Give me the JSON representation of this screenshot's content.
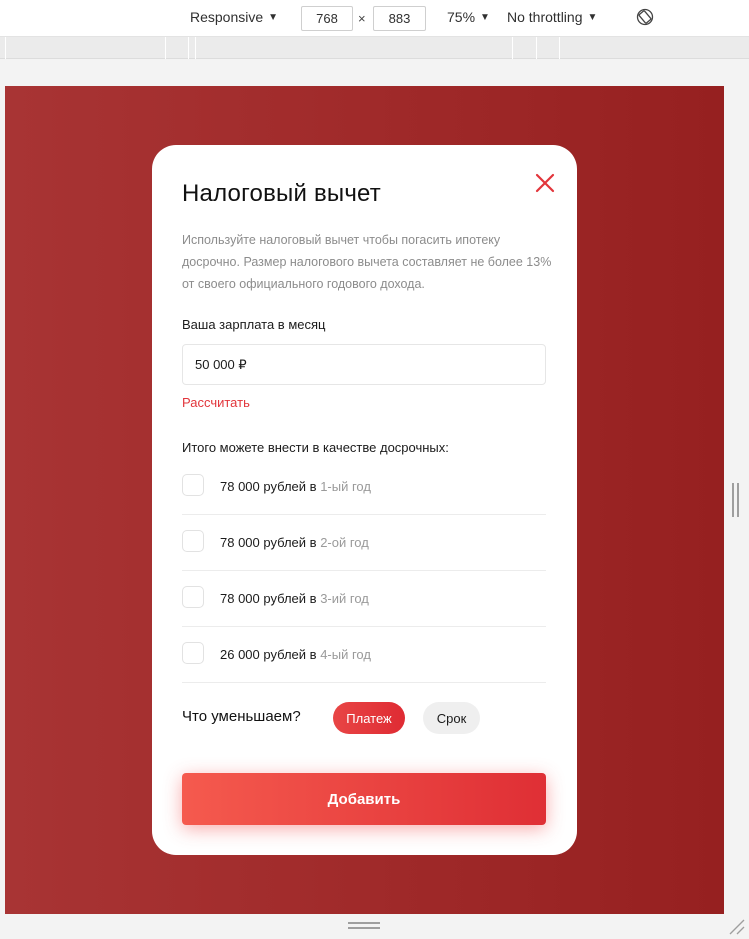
{
  "devtools": {
    "device": "Responsive",
    "width": "768",
    "times": "×",
    "height": "883",
    "zoom": "75%",
    "throttling": "No throttling",
    "rotate_icon": "rotate-icon"
  },
  "modal": {
    "title": "Налоговый вычет",
    "close_icon": "close-icon",
    "description": "Используйте налоговый вычет чтобы погасить ипотеку досрочно. Размер налогового вычета составляет не более 13% от своего официального годового дохода.",
    "salary_label": "Ваша зарплата в месяц",
    "salary_value": "50 000 ₽",
    "calc_link": "Рассчитать",
    "total_label": "Итого можете внести в качестве досрочных:",
    "options": [
      {
        "amount": "78 000 рублей в ",
        "year": "1-ый год",
        "checked": false
      },
      {
        "amount": "78 000 рублей в ",
        "year": "2-ой год",
        "checked": false
      },
      {
        "amount": "78 000 рублей в ",
        "year": "3-ий год",
        "checked": false
      },
      {
        "amount": "26 000 рублей в ",
        "year": "4-ый год",
        "checked": false
      }
    ],
    "reduce_label": "Что уменьшаем?",
    "reduce_options": {
      "payment": "Платеж",
      "term": "Срок",
      "selected": "payment"
    },
    "submit_label": "Добавить"
  },
  "colors": {
    "accent": "#e2353b",
    "page_background": "#a02a2a",
    "button_gradient_start": "#f55a4e",
    "button_gradient_end": "#df2f35"
  }
}
